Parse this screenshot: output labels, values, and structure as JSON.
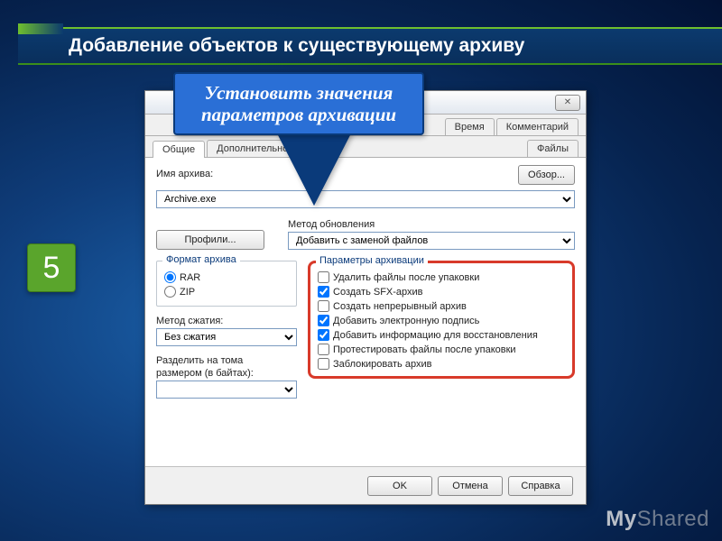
{
  "slide": {
    "title": "Добавление объектов к существующему архиву",
    "step_number": "5",
    "callout": "Установить значения параметров архивации",
    "watermark_prefix": "My",
    "watermark_suffix": "Shared"
  },
  "dialog": {
    "tabs_top": [
      "Время",
      "Комментарий"
    ],
    "tabs_bottom": [
      "Общие",
      "Дополнительно",
      "Файлы"
    ],
    "archive_name_label": "Имя архива:",
    "archive_name_value": "Archive.exe",
    "browse": "Обзор...",
    "profiles": "Профили...",
    "update_method_label": "Метод обновления",
    "update_method_value": "Добавить с заменой файлов",
    "format_legend": "Формат архива",
    "formats": [
      {
        "label": "RAR",
        "checked": true
      },
      {
        "label": "ZIP",
        "checked": false
      }
    ],
    "compression_label": "Метод сжатия:",
    "compression_value": "Без сжатия",
    "split_label_1": "Разделить на тома",
    "split_label_2": "размером (в байтах):",
    "split_value": "",
    "params_legend": "Параметры архивации",
    "params": [
      {
        "label": "Удалить файлы после упаковки",
        "checked": false
      },
      {
        "label": "Создать SFX-архив",
        "checked": true
      },
      {
        "label": "Создать непрерывный архив",
        "checked": false
      },
      {
        "label": "Добавить электронную подпись",
        "checked": true
      },
      {
        "label": "Добавить информацию для восстановления",
        "checked": true
      },
      {
        "label": "Протестировать файлы после упаковки",
        "checked": false
      },
      {
        "label": "Заблокировать архив",
        "checked": false
      }
    ],
    "ok": "OK",
    "cancel": "Отмена",
    "help": "Справка"
  }
}
